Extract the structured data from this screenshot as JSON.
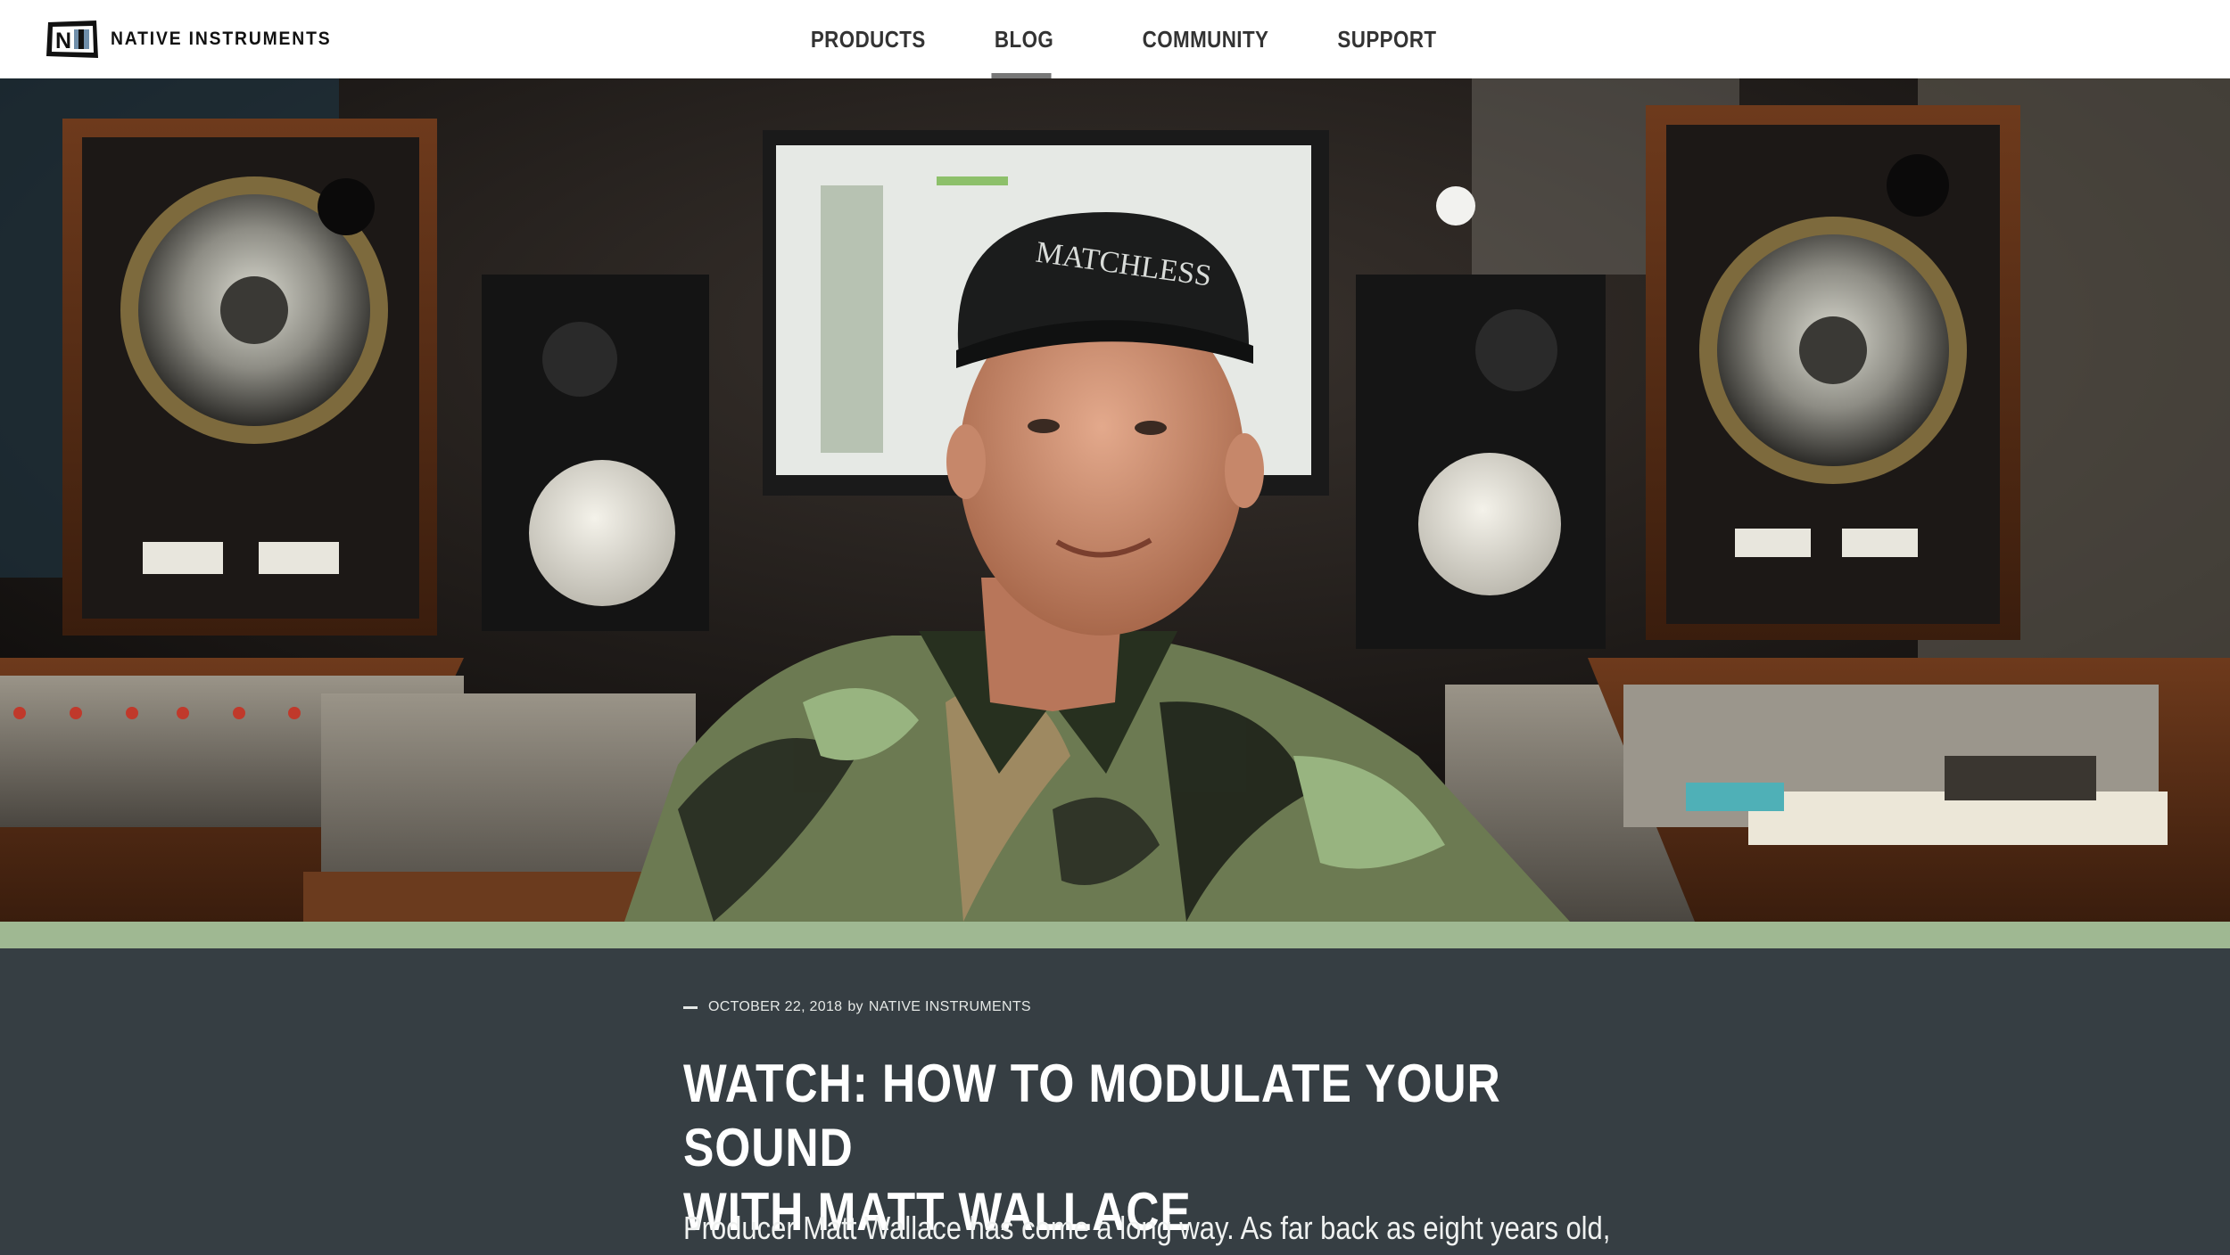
{
  "header": {
    "logo_text": "NATIVE INSTRUMENTS",
    "logo_letters": "NI",
    "nav": [
      {
        "label": "PRODUCTS",
        "active": false
      },
      {
        "label": "BLOG",
        "active": true
      },
      {
        "label": "COMMUNITY",
        "active": false
      },
      {
        "label": "SUPPORT",
        "active": false
      }
    ]
  },
  "hero": {
    "image_subject": "producer in studio with speakers and mixing console",
    "cap_text": "MATCHLESS"
  },
  "article": {
    "date": "OCTOBER 22, 2018",
    "by": "by",
    "author": "NATIVE INSTRUMENTS",
    "title_line1": "WATCH: HOW TO MODULATE YOUR SOUND",
    "title_line2": "WITH MATT WALLACE",
    "lede": "Producer Matt Wallace has come a long way. As far back as eight years old,"
  },
  "colors": {
    "header_bg": "#ffffff",
    "article_bg": "#363e43",
    "stripe": "#9fb892",
    "nav_text": "#333333",
    "active_underline": "#777777"
  }
}
